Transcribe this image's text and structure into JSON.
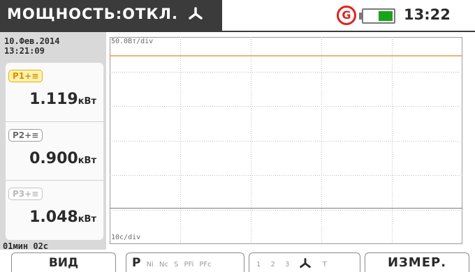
{
  "header": {
    "title": "МОЩНОСТЬ:ОТКЛ.",
    "title_icon": "three-phase-star-icon",
    "generator_icon_label": "G",
    "battery_level": 0.5,
    "time": "13:22"
  },
  "left_panel": {
    "date": "10.Фев.2014",
    "time": "13:21:09",
    "channels": [
      {
        "label": "P1+≡",
        "value": "1.119",
        "unit": "кВт",
        "state": "selected"
      },
      {
        "label": "P2+≡",
        "value": "0.900",
        "unit": "кВт",
        "state": "normal"
      },
      {
        "label": "P3+≡",
        "value": "1.048",
        "unit": "кВт",
        "state": "dim"
      }
    ],
    "elapsed": "01мин 02с"
  },
  "plot": {
    "y_scale_label": "50.0Вт/div",
    "x_scale_label": "10с/div",
    "trace_color": "#e89a4a",
    "grid_color": "#bdbdbd"
  },
  "chart_data": {
    "type": "line",
    "title": "",
    "xlabel": "",
    "ylabel": "",
    "grid": true,
    "x_divisions": 5,
    "y_divisions": 6,
    "series": [
      {
        "name": "P1+≡",
        "values": [
          1119,
          1119,
          1119,
          1119,
          1119,
          1119
        ]
      }
    ]
  },
  "bottom_bar": {
    "view_label": "ВИД",
    "param_label": "P",
    "param_options": [
      "Ni",
      "Nc",
      "S",
      "PFi",
      "PFc"
    ],
    "phase_options": [
      "1",
      "2",
      "3"
    ],
    "phase_trailing": "T",
    "measure_label": "ИЗМЕР."
  }
}
